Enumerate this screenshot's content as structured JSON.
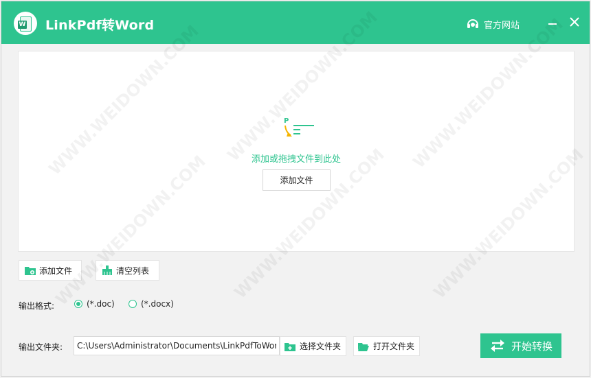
{
  "app": {
    "title": "LinkPdf转Word",
    "official_site_label": "官方网站"
  },
  "dropzone": {
    "hint": "添加或拖拽文件到此处",
    "add_file_label": "添加文件"
  },
  "toolbar": {
    "add_file_label": "添加文件",
    "clear_list_label": "清空列表"
  },
  "output_format": {
    "label": "输出格式:",
    "options": [
      {
        "label": "(*.doc)",
        "selected": true
      },
      {
        "label": "(*.docx)",
        "selected": false
      }
    ]
  },
  "output_folder": {
    "label": "输出文件夹:",
    "path": "C:\\Users\\Administrator\\Documents\\LinkPdfToWord",
    "choose_label": "选择文件夹",
    "open_label": "打开文件夹"
  },
  "start_button_label": "开始转换",
  "watermark_text": "WWW.WEIDOWN.COM",
  "colors": {
    "accent": "#2ec48f",
    "background": "#f2f2f2"
  }
}
